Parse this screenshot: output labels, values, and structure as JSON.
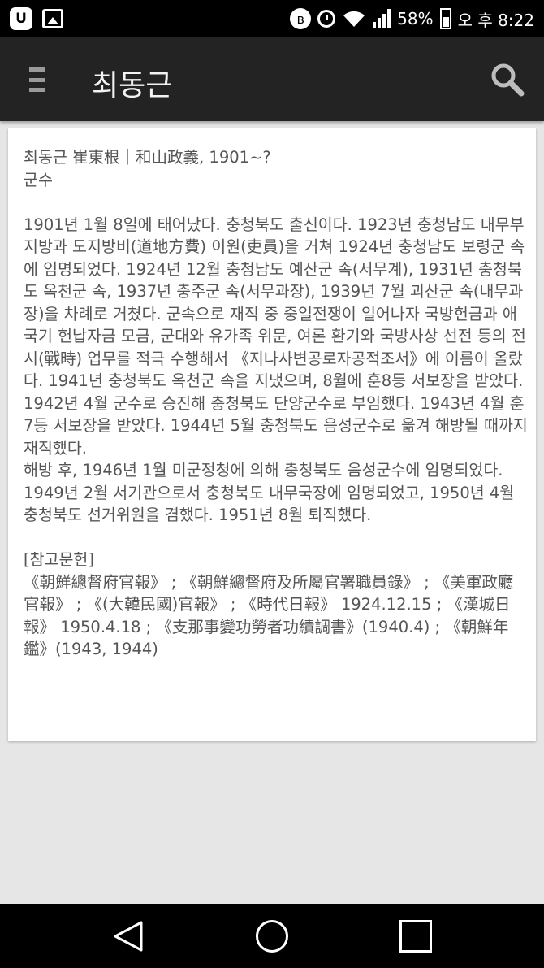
{
  "status_bar": {
    "battery": "58%",
    "time": "오 후 8:22",
    "app_icon_glyph": "U",
    "bluetooth_glyph": "ʙ",
    "icons": [
      "app-icon",
      "gallery-icon",
      "bluetooth-icon",
      "alarm-icon",
      "wifi-icon",
      "signal-icon",
      "battery-icon"
    ]
  },
  "app_bar": {
    "title": "최동근",
    "menu_icon": "hamburger-menu-icon",
    "search_icon": "search-icon"
  },
  "article": {
    "header_line": "최동근 崔東根｜和山政義, 1901~?",
    "subtitle": "군수",
    "body_paragraph_1": "1901년 1월 8일에 태어났다. 충청북도 출신이다. 1923년 충청남도 내무부 지방과 도지방비(道地方費) 이원(吏員)을 거쳐 1924년 충청남도 보령군 속에 임명되었다. 1924년 12월 충청남도 예산군 속(서무계), 1931년 충청북도 옥천군 속, 1937년 충주군 속(서무과장), 1939년 7월 괴산군 속(내무과장)을 차례로 거쳤다. 군속으로 재직 중 중일전쟁이 일어나자 국방헌금과 애국기 헌납자금 모금, 군대와 유가족 위문, 여론 환기와 국방사상 선전 등의 전시(戰時) 업무를 적극 수행해서 《지나사변공로자공적조서》에 이름이 올랐다. 1941년 충청북도 옥천군 속을 지냈으며, 8월에 훈8등 서보장을 받았다. 1942년 4월 군수로 승진해 충청북도 단양군수로 부임했다. 1943년 4월 훈7등 서보장을 받았다. 1944년 5월 충청북도 음성군수로 옮겨 해방될 때까지 재직했다.",
    "body_paragraph_2": "해방 후, 1946년 1월 미군정청에 의해 충청북도 음성군수에 임명되었다. 1949년 2월 서기관으로서 충청북도 내무국장에 임명되었고, 1950년 4월 충청북도 선거위원을 겸했다. 1951년 8월 퇴직했다.",
    "references_heading": "[참고문헌]",
    "references": "《朝鮮總督府官報》 ; 《朝鮮總督府及所屬官署職員錄》 ; 《美軍政廳官報》 ; 《(大韓民國)官報》 ; 《時代日報》 1924.12.15 ; 《漢城日報》 1950.4.18 ; 《支那事變功勞者功績調書》(1940.4) ; 《朝鮮年鑑》(1943, 1944)"
  },
  "nav_bar": {
    "icons": [
      "back-icon",
      "home-icon",
      "recents-icon"
    ]
  }
}
